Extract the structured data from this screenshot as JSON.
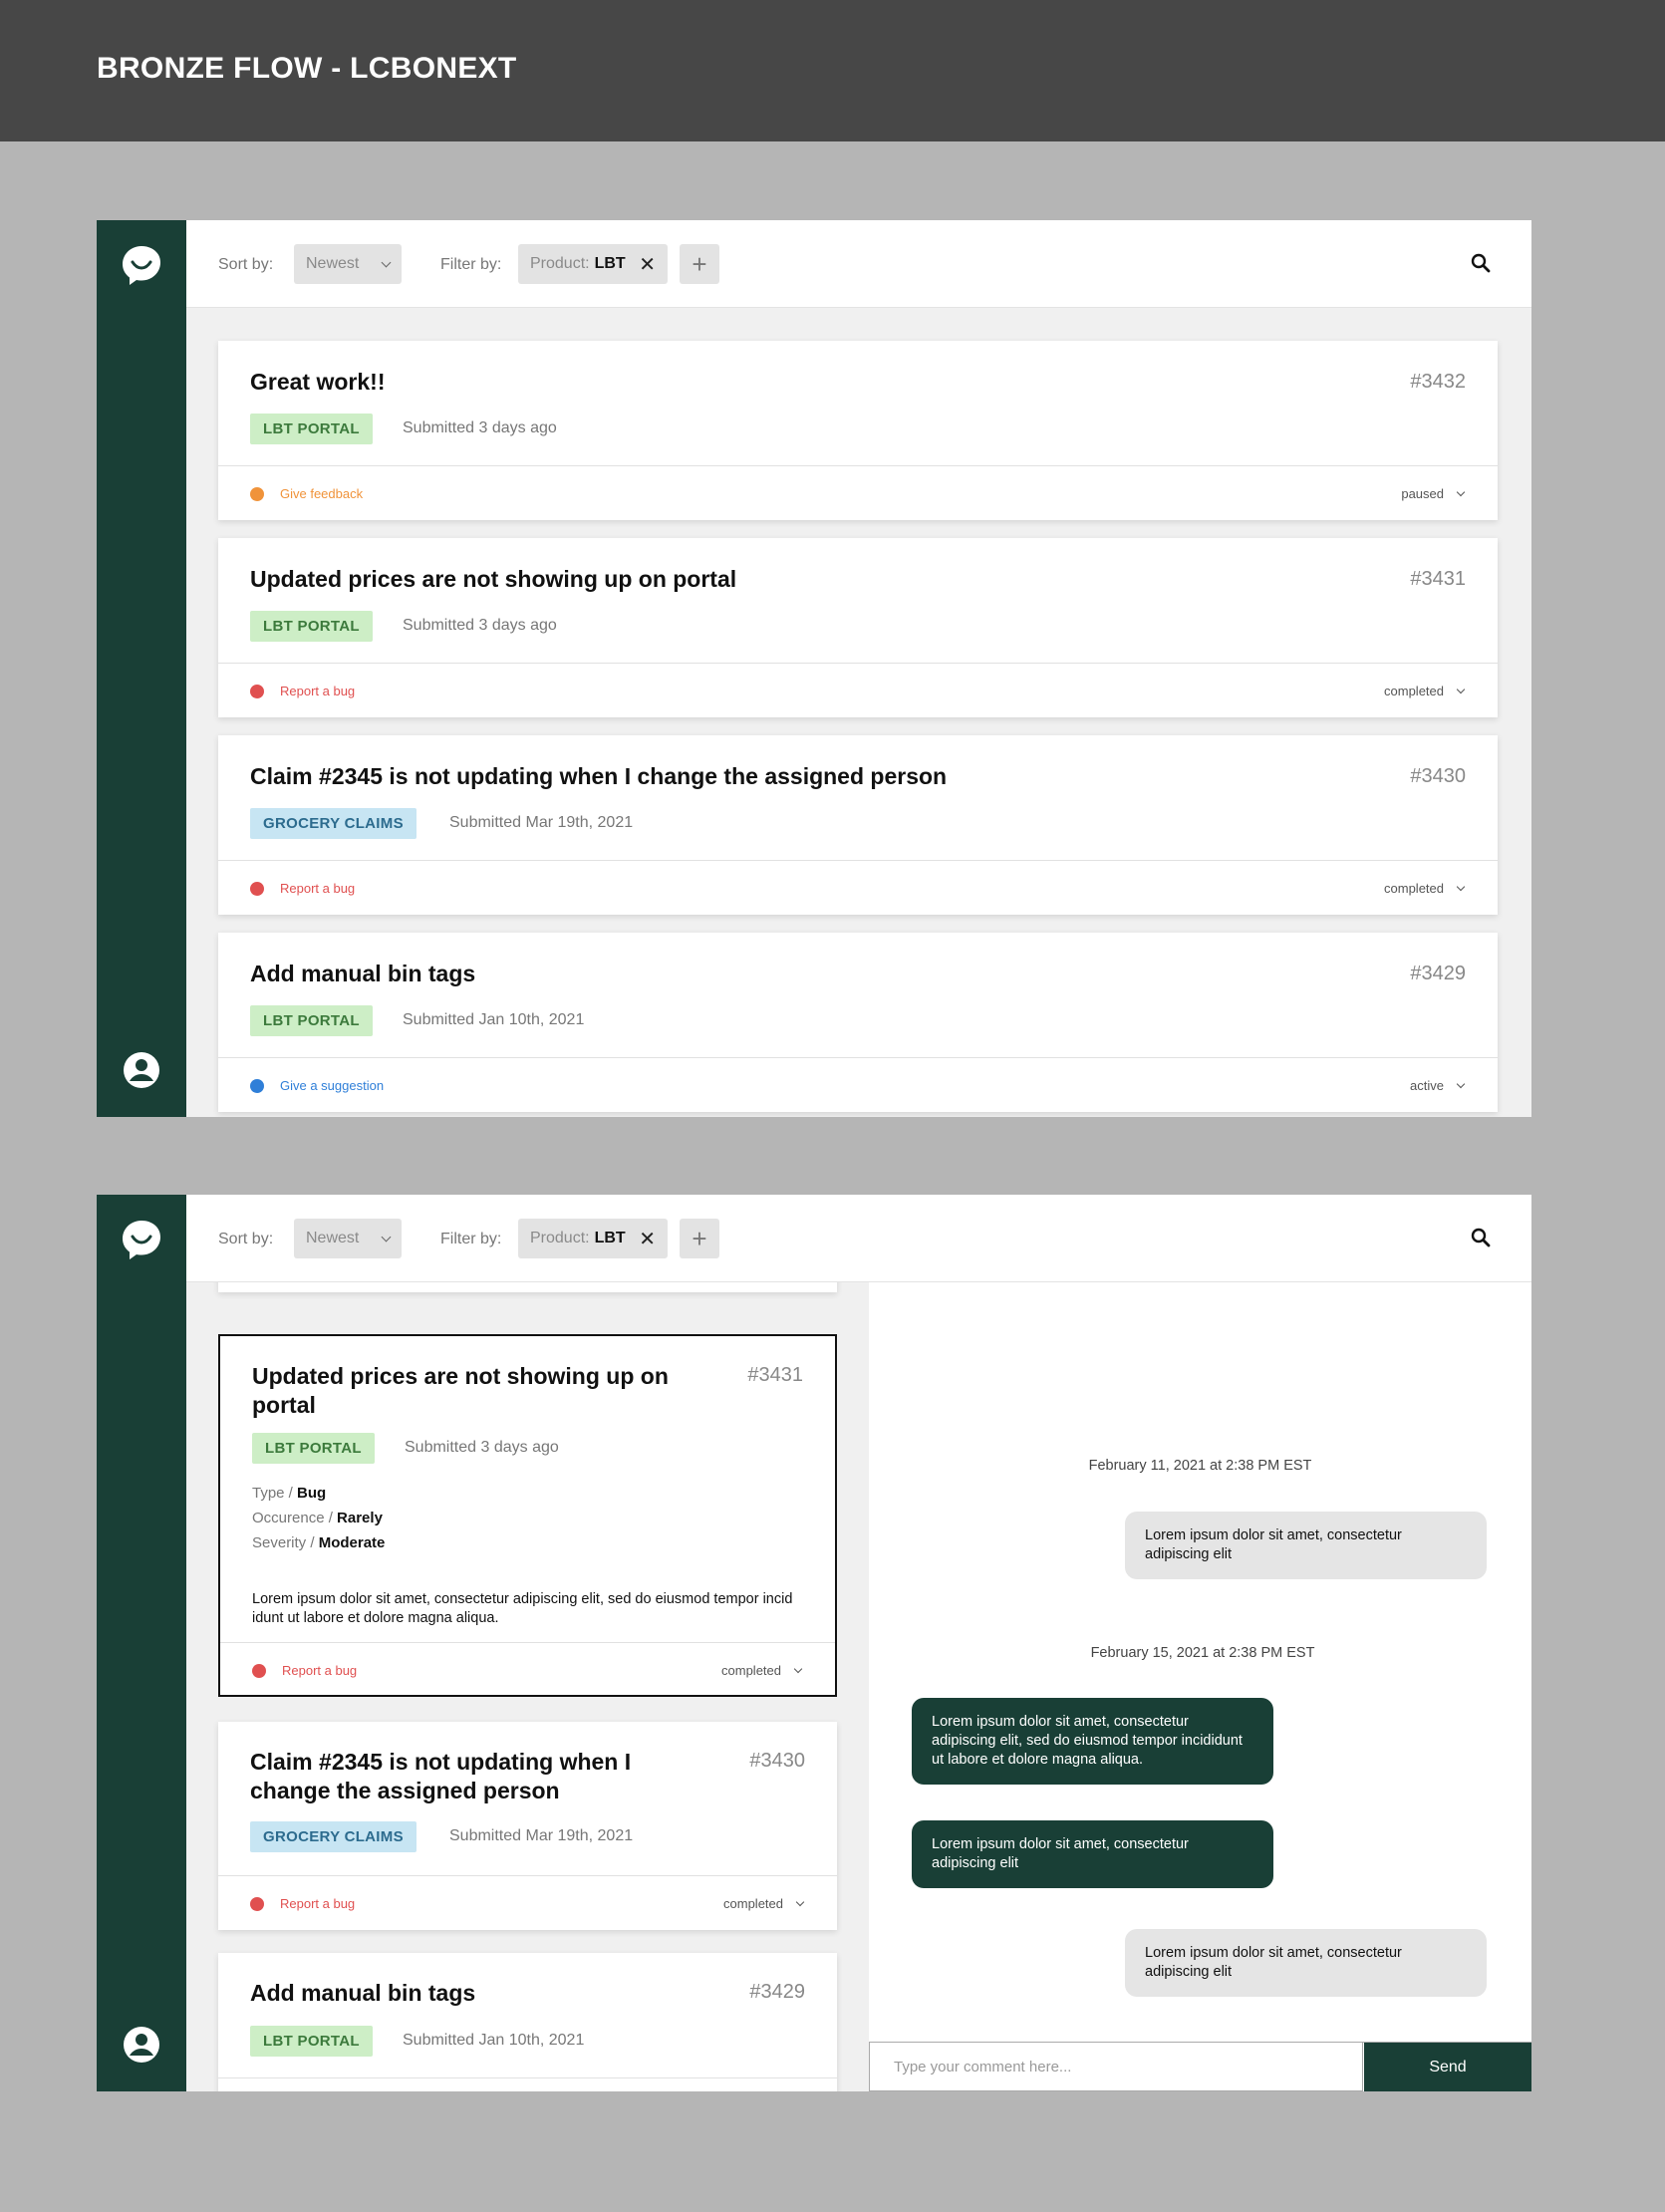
{
  "page_title": "BRONZE FLOW - LCBONEXT",
  "header": {
    "sort_label": "Sort by:",
    "sort_value": "Newest",
    "filter_label": "Filter by:",
    "filter_key": "Product:",
    "filter_value": "LBT",
    "filter_remove": "✕",
    "add_filter": "+"
  },
  "tickets": [
    {
      "title": "Great work!!",
      "id": "#3432",
      "tag": "LBT PORTAL",
      "submitted": "Submitted 3 days ago",
      "category": "Give feedback",
      "status": "paused"
    },
    {
      "title": "Updated prices are not showing up on portal",
      "id": "#3431",
      "tag": "LBT PORTAL",
      "submitted": "Submitted 3 days ago",
      "category": "Report a bug",
      "status": "completed"
    },
    {
      "title": "Claim #2345 is not updating when I change the assigned person",
      "id": "#3430",
      "tag": "GROCERY CLAIMS",
      "submitted": "Submitted Mar 19th, 2021",
      "category": "Report a bug",
      "status": "completed"
    },
    {
      "title": "Add manual bin tags",
      "id": "#3429",
      "tag": "LBT PORTAL",
      "submitted": "Submitted Jan 10th, 2021",
      "category": "Give a suggestion",
      "status": "active"
    }
  ],
  "detail": {
    "type_label": "Type /",
    "type_value": "Bug",
    "occurence_label": "Occurence /",
    "occurence_value": "Rarely",
    "severity_label": "Severity /",
    "severity_value": "Moderate",
    "description": "Lorem ipsum dolor sit amet, consectetur adipiscing elit, sed do eiusmod tempor incid idunt ut labore et dolore magna aliqua."
  },
  "chat": {
    "date1": "February 11, 2021 at 2:38 PM EST",
    "msg1": "Lorem ipsum dolor sit amet, consectetur adipiscing elit",
    "date2": "February 15, 2021 at 2:38 PM EST",
    "msg2": "Lorem ipsum dolor sit amet, consectetur adipiscing elit, sed do eiusmod tempor incididunt ut labore et dolore magna aliqua.",
    "msg3": "Lorem ipsum dolor sit amet, consectetur adipiscing elit",
    "msg4": "Lorem ipsum dolor sit amet, consectetur adipiscing elit",
    "input_placeholder": "Type your comment here...",
    "send_label": "Send"
  },
  "colors": {
    "sidebar": "#193f36",
    "feedback": "#f0933a",
    "bug": "#e05050",
    "suggestion": "#2f7fd8"
  }
}
